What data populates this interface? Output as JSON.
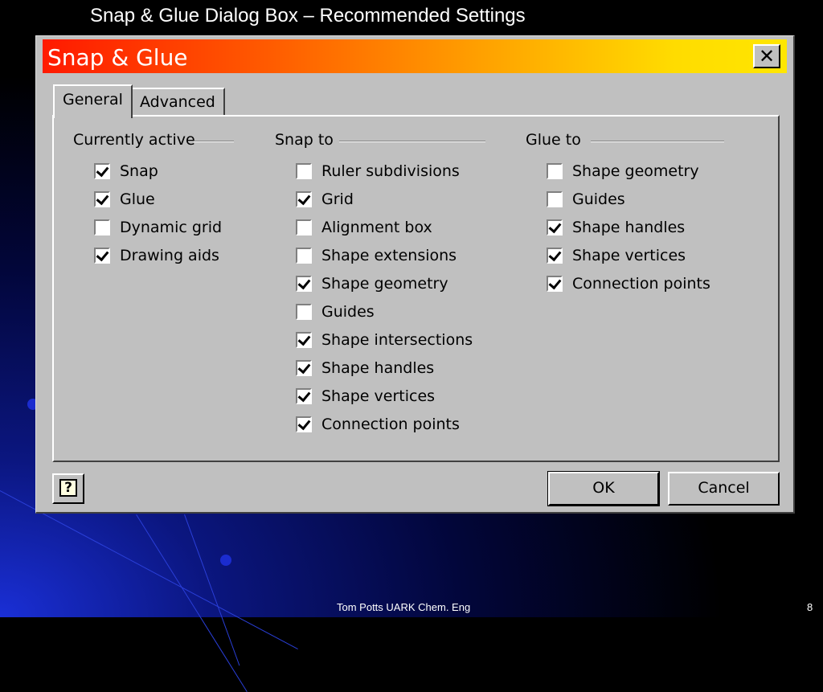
{
  "slide": {
    "title": "Snap & Glue Dialog Box – Recommended Settings",
    "footer": "Tom Potts  UARK Chem. Eng",
    "page_number": "8"
  },
  "dialog": {
    "title": "Snap & Glue",
    "close_icon": "close-icon",
    "tabs": [
      {
        "label": "General",
        "selected": true
      },
      {
        "label": "Advanced",
        "selected": false
      }
    ],
    "groups": [
      {
        "label": "Currently active",
        "items": [
          {
            "label": "Snap",
            "checked": true
          },
          {
            "label": "Glue",
            "checked": true
          },
          {
            "label": "Dynamic grid",
            "checked": false
          },
          {
            "label": "Drawing aids",
            "checked": true
          }
        ]
      },
      {
        "label": "Snap to",
        "items": [
          {
            "label": "Ruler subdivisions",
            "checked": false
          },
          {
            "label": "Grid",
            "checked": true
          },
          {
            "label": "Alignment box",
            "checked": false
          },
          {
            "label": "Shape extensions",
            "checked": false
          },
          {
            "label": "Shape geometry",
            "checked": true
          },
          {
            "label": "Guides",
            "checked": false
          },
          {
            "label": "Shape intersections",
            "checked": true
          },
          {
            "label": "Shape handles",
            "checked": true
          },
          {
            "label": "Shape vertices",
            "checked": true
          },
          {
            "label": "Connection points",
            "checked": true
          }
        ]
      },
      {
        "label": "Glue to",
        "items": [
          {
            "label": "Shape geometry",
            "checked": false
          },
          {
            "label": "Guides",
            "checked": false
          },
          {
            "label": "Shape handles",
            "checked": true
          },
          {
            "label": "Shape vertices",
            "checked": true
          },
          {
            "label": "Connection points",
            "checked": true
          }
        ]
      }
    ],
    "help_icon": "help-icon",
    "help_glyph": "?",
    "ok_label": "OK",
    "cancel_label": "Cancel"
  }
}
